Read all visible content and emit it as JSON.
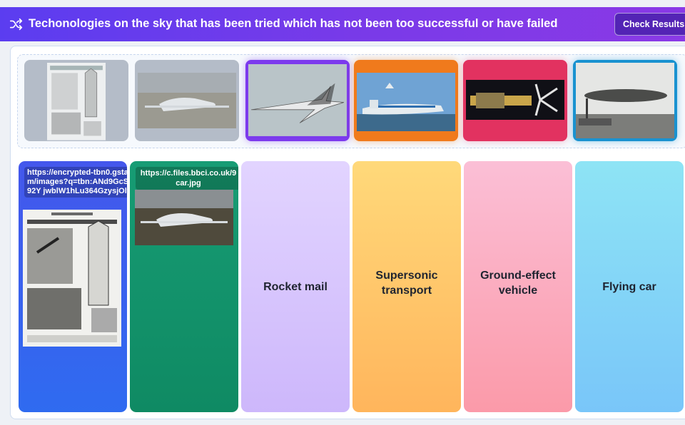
{
  "header": {
    "title": "Techonologies on the sky that has been tried which has not been too successful or have failed",
    "check_label": "Check Results",
    "icon": "shuffle-icon"
  },
  "pool": {
    "tiles": [
      {
        "subject": "rocket-mail-magazine-page",
        "state": "used"
      },
      {
        "subject": "flying-car",
        "state": "used"
      },
      {
        "subject": "supersonic-jet",
        "state": "available",
        "accent": "#7c3aed"
      },
      {
        "subject": "ground-effect-vehicle",
        "state": "available",
        "accent": "#f07a1c"
      },
      {
        "subject": "nuclear-aircraft-engine",
        "state": "available",
        "accent": "#e23260"
      },
      {
        "subject": "airship",
        "state": "available",
        "accent": "#1992d0"
      }
    ]
  },
  "zones": [
    {
      "dropped_url": "https://encrypted-tbn0.gstatic.com/images?q=tbn:ANd9GcSWu7g92Y jwblW1hLu364GzysjOlwv9",
      "accent": "#3f57ea"
    },
    {
      "dropped_url": "https://c.files.bbci.co.uk/9 car.jpg",
      "accent": "#17a377"
    },
    {
      "label": "Rocket mail",
      "accent": "#d9c2ff"
    },
    {
      "label": "Supersonic transport",
      "accent": "#ffcb6e"
    },
    {
      "label": "Ground-effect vehicle",
      "accent": "#fbb2c6"
    },
    {
      "label": "Flying car",
      "accent": "#7fd5f8"
    }
  ]
}
